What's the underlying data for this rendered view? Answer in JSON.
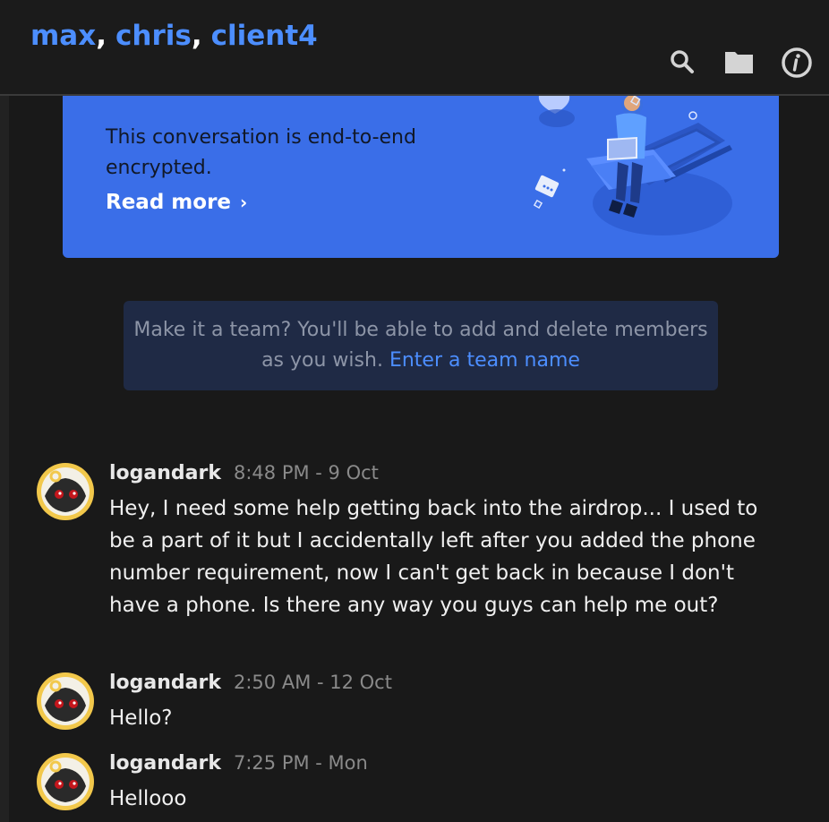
{
  "header": {
    "participants": [
      "max",
      "chris",
      "client4"
    ],
    "separator": ","
  },
  "icons": {
    "search": "search-icon",
    "folder": "folder-icon",
    "info": "info-icon"
  },
  "banner": {
    "text": "This conversation is end-to-end encrypted.",
    "read_more": "Read more",
    "chevron": "›"
  },
  "team_prompt": {
    "text": "Make it a team? You'll be able to add and delete members as you wish.",
    "link": "Enter a team name"
  },
  "messages": [
    {
      "author": "logandark",
      "time": "8:48 PM - 9 Oct",
      "text": "Hey, I need some help getting back into the airdrop... I used to be a part of it but I accidentally left after you added the phone number requirement, now I can't get back in because I don't have a phone. Is there any way you guys can help me out?"
    },
    {
      "author": "logandark",
      "time": "2:50 AM - 12 Oct",
      "text": "Hello?"
    },
    {
      "author": "logandark",
      "time": "7:25 PM - Mon",
      "text": "Hellooo"
    }
  ],
  "colors": {
    "accent": "#4c8eff",
    "banner": "#3a6ee8",
    "team_box": "#1f2a45",
    "background": "#191919"
  }
}
